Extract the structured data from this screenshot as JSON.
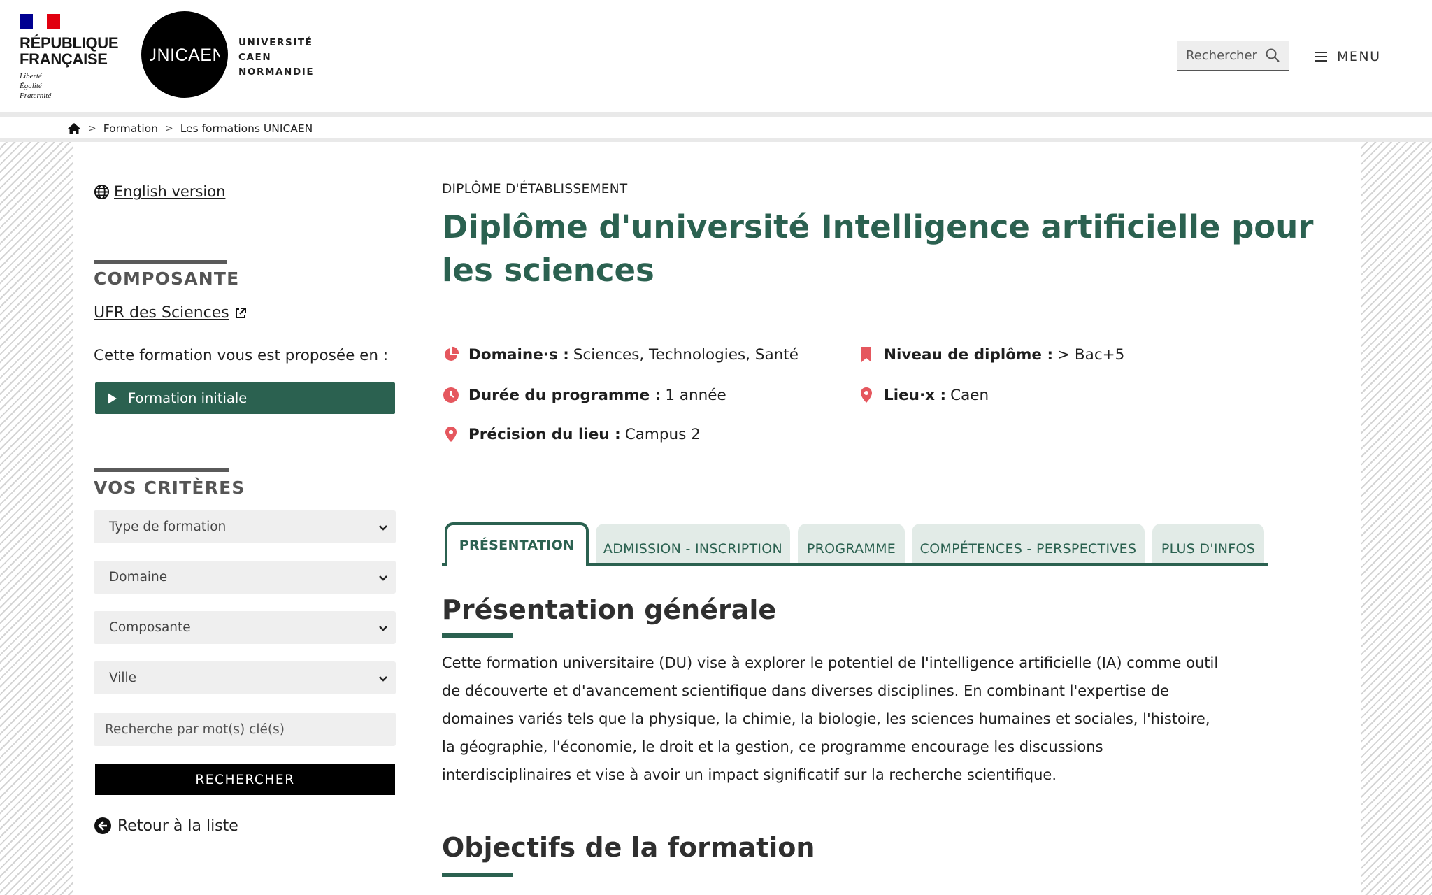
{
  "header": {
    "republique": {
      "title": "RÉPUBLIQUE\nFRANÇAISE",
      "motto": "Liberté\nÉgalité\nFraternité"
    },
    "logo_text": "UNICAEN",
    "university_name": "UNIVERSITÉ\nCAEN\nNORMANDIE",
    "search_label": "Rechercher",
    "menu_label": "MENU"
  },
  "breadcrumb": {
    "items": [
      "Formation",
      "Les formations UNICAEN"
    ],
    "separator": ">"
  },
  "sidebar": {
    "english_link": "English version",
    "composante_heading": "COMPOSANTE",
    "ufr_link": "UFR des Sciences",
    "proposee_text": "Cette formation vous est proposée en :",
    "formation_initiale": "Formation initiale",
    "criteres_heading": "VOS CRITÈRES",
    "selects": [
      "Type de formation",
      "Domaine",
      "Composante",
      "Ville"
    ],
    "keyword_placeholder": "Recherche par mot(s) clé(s)",
    "search_button": "RECHERCHER",
    "back_link": "Retour à la liste"
  },
  "main": {
    "diploma_type": "DIPLÔME D'ÉTABLISSEMENT",
    "title": "Diplôme d'université Intelligence artificielle pour les sciences",
    "info": {
      "domaines": {
        "label": "Domaine·s :",
        "value": "Sciences, Technologies, Santé"
      },
      "niveau": {
        "label": "Niveau de diplôme :",
        "value": "> Bac+5"
      },
      "duree": {
        "label": "Durée du programme :",
        "value": "1 année"
      },
      "lieux": {
        "label": "Lieu·x :",
        "value": "Caen"
      },
      "precision": {
        "label": "Précision du lieu :",
        "value": "Campus 2"
      }
    },
    "tabs": [
      "PRÉSENTATION",
      "ADMISSION - INSCRIPTION",
      "PROGRAMME",
      "COMPÉTENCES - PERSPECTIVES",
      "PLUS D'INFOS"
    ],
    "presentation_title": "Présentation générale",
    "presentation_text": "Cette formation universitaire (DU) vise à explorer le potentiel de l'intelligence artificielle (IA) comme outil de découverte et d'avancement scientifique dans diverses disciplines. En combinant l'expertise de domaines variés tels que la physique, la chimie, la biologie, les sciences humaines et sociales, l'histoire, la géographie, l'économie, le droit et la gestion, ce programme encourage les discussions interdisciplinaires et vise à avoir un impact significatif sur la recherche scientifique.",
    "objectifs_title": "Objectifs de la formation"
  },
  "colors": {
    "accent": "#2b6150",
    "icon_red": "#e5575e",
    "tab_bg": "#e2ebe7"
  }
}
